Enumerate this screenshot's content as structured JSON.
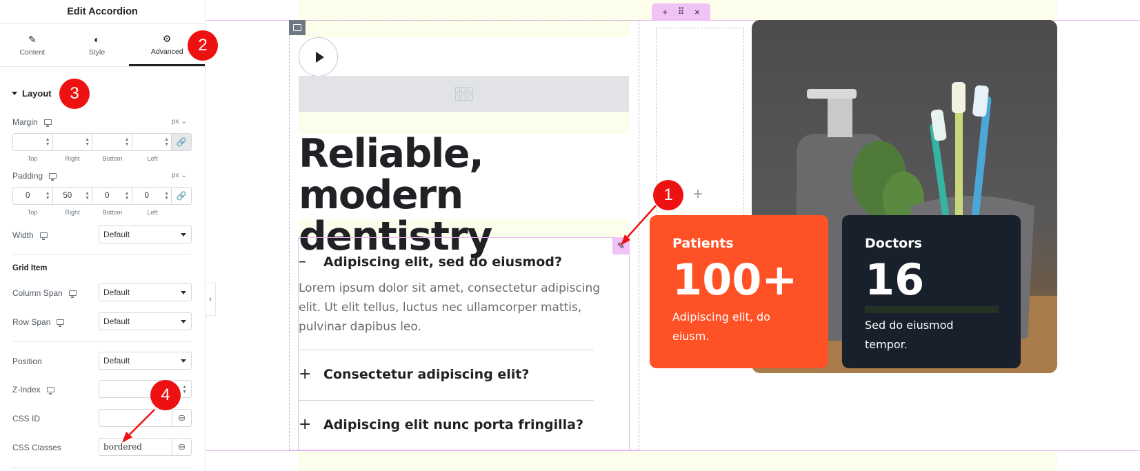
{
  "panel": {
    "title": "Edit Accordion",
    "tabs": [
      {
        "label": "Content",
        "icon": "pencil-icon"
      },
      {
        "label": "Style",
        "icon": "contrast-icon"
      },
      {
        "label": "Advanced",
        "icon": "gear-icon",
        "active": true
      }
    ],
    "section": "Layout",
    "margin": {
      "label": "Margin",
      "unit": "px",
      "values": [
        "",
        "",
        "",
        ""
      ]
    },
    "padding": {
      "label": "Padding",
      "unit": "px",
      "values": [
        "0",
        "50",
        "0",
        "0"
      ]
    },
    "sides": [
      "Top",
      "Right",
      "Bottom",
      "Left"
    ],
    "width": {
      "label": "Width",
      "value": "Default"
    },
    "grid_item": {
      "title": "Grid Item",
      "column_span": {
        "label": "Column Span",
        "value": "Default"
      },
      "row_span": {
        "label": "Row Span",
        "value": "Default"
      }
    },
    "position": {
      "label": "Position",
      "value": "Default"
    },
    "z_index": {
      "label": "Z-Index"
    },
    "css_id": {
      "label": "CSS ID",
      "value": ""
    },
    "css_classes": {
      "label": "CSS Classes",
      "value": "bordered"
    }
  },
  "callouts": [
    "1",
    "2",
    "3",
    "4"
  ],
  "canvas": {
    "headline": "Reliable, modern dentistry",
    "accordion": {
      "items": [
        {
          "symbol": "–",
          "title": "Adipiscing elit, sed do eiusmod?"
        },
        {
          "symbol": "+",
          "title": "Consectetur adipiscing elit?"
        },
        {
          "symbol": "+",
          "title": "Adipiscing elit nunc porta fringilla?"
        }
      ],
      "open_text": "Lorem ipsum dolor sit amet, consectetur adipiscing elit. Ut elit tellus, luctus nec ullamcorper mattis, pulvinar dapibus leo."
    },
    "handle_icons": [
      "+",
      "⠿",
      "×"
    ],
    "stats": [
      {
        "label": "Patients",
        "number": "100+",
        "desc": "Adipiscing elit, do eiusm."
      },
      {
        "label": "Doctors",
        "number": "16",
        "desc": "Sed do eiusmod tempor."
      }
    ]
  },
  "colors": {
    "accent_orange": "#ff5126",
    "dark_card": "#17202b",
    "editor_pink": "#f1c2f6",
    "callout_red": "#ee1111"
  }
}
